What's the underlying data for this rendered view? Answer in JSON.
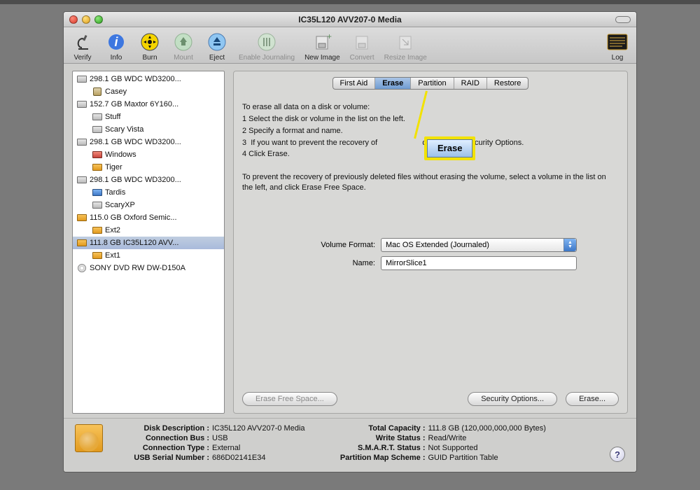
{
  "window": {
    "title": "IC35L120 AVV207-0 Media"
  },
  "toolbar": {
    "verify": "Verify",
    "info": "Info",
    "burn": "Burn",
    "mount": "Mount",
    "eject": "Eject",
    "journaling": "Enable Journaling",
    "newimage": "New Image",
    "convert": "Convert",
    "resize": "Resize Image",
    "log": "Log"
  },
  "tabs": {
    "firstaid": "First Aid",
    "erase": "Erase",
    "partition": "Partition",
    "raid": "RAID",
    "restore": "Restore"
  },
  "sidebar": {
    "items": [
      {
        "label": "298.1 GB WDC WD3200...",
        "icon": "hd"
      },
      {
        "label": "Casey",
        "icon": "face",
        "child": true
      },
      {
        "label": "152.7 GB Maxtor 6Y160...",
        "icon": "hd"
      },
      {
        "label": "Stuff",
        "icon": "hd",
        "child": true
      },
      {
        "label": "Scary Vista",
        "icon": "hd",
        "child": true
      },
      {
        "label": "298.1 GB WDC WD3200...",
        "icon": "hd"
      },
      {
        "label": "Windows",
        "icon": "red",
        "child": true
      },
      {
        "label": "Tiger",
        "icon": "orange",
        "child": true
      },
      {
        "label": "298.1 GB WDC WD3200...",
        "icon": "hd"
      },
      {
        "label": "Tardis",
        "icon": "blue",
        "child": true
      },
      {
        "label": "ScaryXP",
        "icon": "hd",
        "child": true
      },
      {
        "label": "115.0 GB Oxford Semic...",
        "icon": "orange"
      },
      {
        "label": "Ext2",
        "icon": "orange",
        "child": true
      },
      {
        "label": "111.8 GB IC35L120 AVV...",
        "icon": "orange",
        "selected": true
      },
      {
        "label": "Ext1",
        "icon": "orange",
        "child": true
      },
      {
        "label": "SONY DVD RW DW-D150A",
        "icon": "cd"
      }
    ]
  },
  "erase": {
    "intro": "To erase all data on a disk or volume:",
    "step1": "1  Select the disk or volume in the list on the left.",
    "step2": "2  Specify a format and name.",
    "step3": "3  If you want to prevent the recovery of                     d data, click Security Options.",
    "step4": "4  Click Erase.",
    "note": "To prevent the recovery of previously deleted files without erasing the volume, select a volume in the list on the left, and click Erase Free Space.",
    "callout": "Erase",
    "format_label": "Volume Format:",
    "format_value": "Mac OS Extended (Journaled)",
    "name_label": "Name:",
    "name_value": "MirrorSlice1",
    "btn_freespace": "Erase Free Space...",
    "btn_security": "Security Options...",
    "btn_erase": "Erase..."
  },
  "footer": {
    "left": {
      "k1": "Disk Description :",
      "v1": "IC35L120 AVV207-0 Media",
      "k2": "Connection Bus :",
      "v2": "USB",
      "k3": "Connection Type :",
      "v3": "External",
      "k4": "USB Serial Number :",
      "v4": "686D02141E34"
    },
    "right": {
      "k1": "Total Capacity :",
      "v1": "111.8 GB (120,000,000,000 Bytes)",
      "k2": "Write Status :",
      "v2": "Read/Write",
      "k3": "S.M.A.R.T. Status :",
      "v3": "Not Supported",
      "k4": "Partition Map Scheme :",
      "v4": "GUID Partition Table"
    }
  }
}
